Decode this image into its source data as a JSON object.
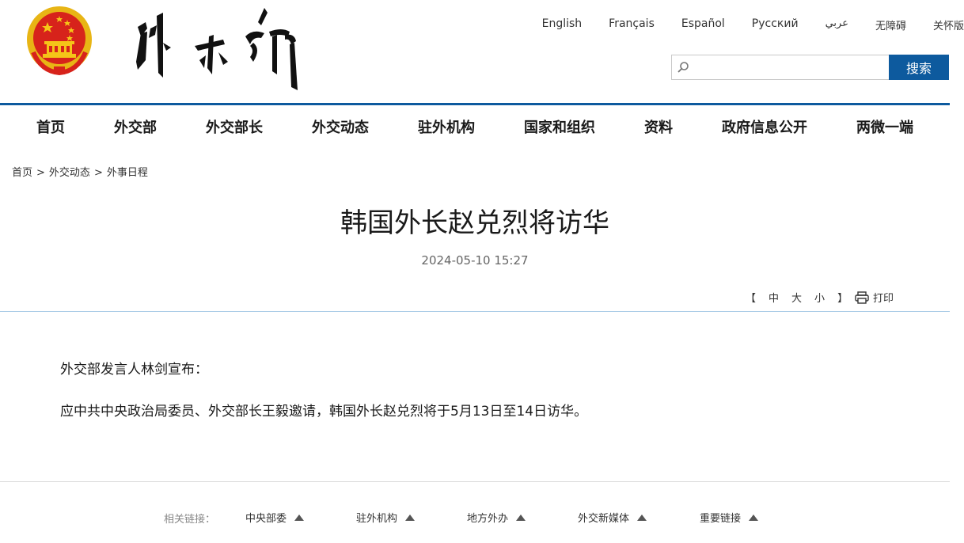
{
  "header": {
    "languages": [
      "English",
      "Français",
      "Español",
      "Русский",
      "عربي",
      "无障碍",
      "关怀版"
    ],
    "search": {
      "placeholder": "",
      "button_label": "搜索"
    }
  },
  "nav": [
    "首页",
    "外交部",
    "外交部长",
    "外交动态",
    "驻外机构",
    "国家和组织",
    "资料",
    "政府信息公开",
    "两微一端"
  ],
  "breadcrumb": [
    "首页",
    "外交动态",
    "外事日程"
  ],
  "article": {
    "title": "韩国外长赵兑烈将访华",
    "date": "2024-05-10 15:27",
    "font_controls": {
      "open": "【",
      "medium": "中",
      "large": "大",
      "small": "小",
      "close": "】"
    },
    "print_label": "打印",
    "paragraphs": [
      "外交部发言人林剑宣布：",
      "应中共中央政治局委员、外交部长王毅邀请，韩国外长赵兑烈将于5月13日至14日访华。"
    ]
  },
  "footer": {
    "label": "相关链接：",
    "links": [
      "中央部委",
      "驻外机构",
      "地方外办",
      "外交新媒体",
      "重要链接"
    ]
  },
  "colors": {
    "brand_blue": "#0d5a9e",
    "emblem_red": "#d7231b",
    "emblem_gold": "#f5c518"
  }
}
